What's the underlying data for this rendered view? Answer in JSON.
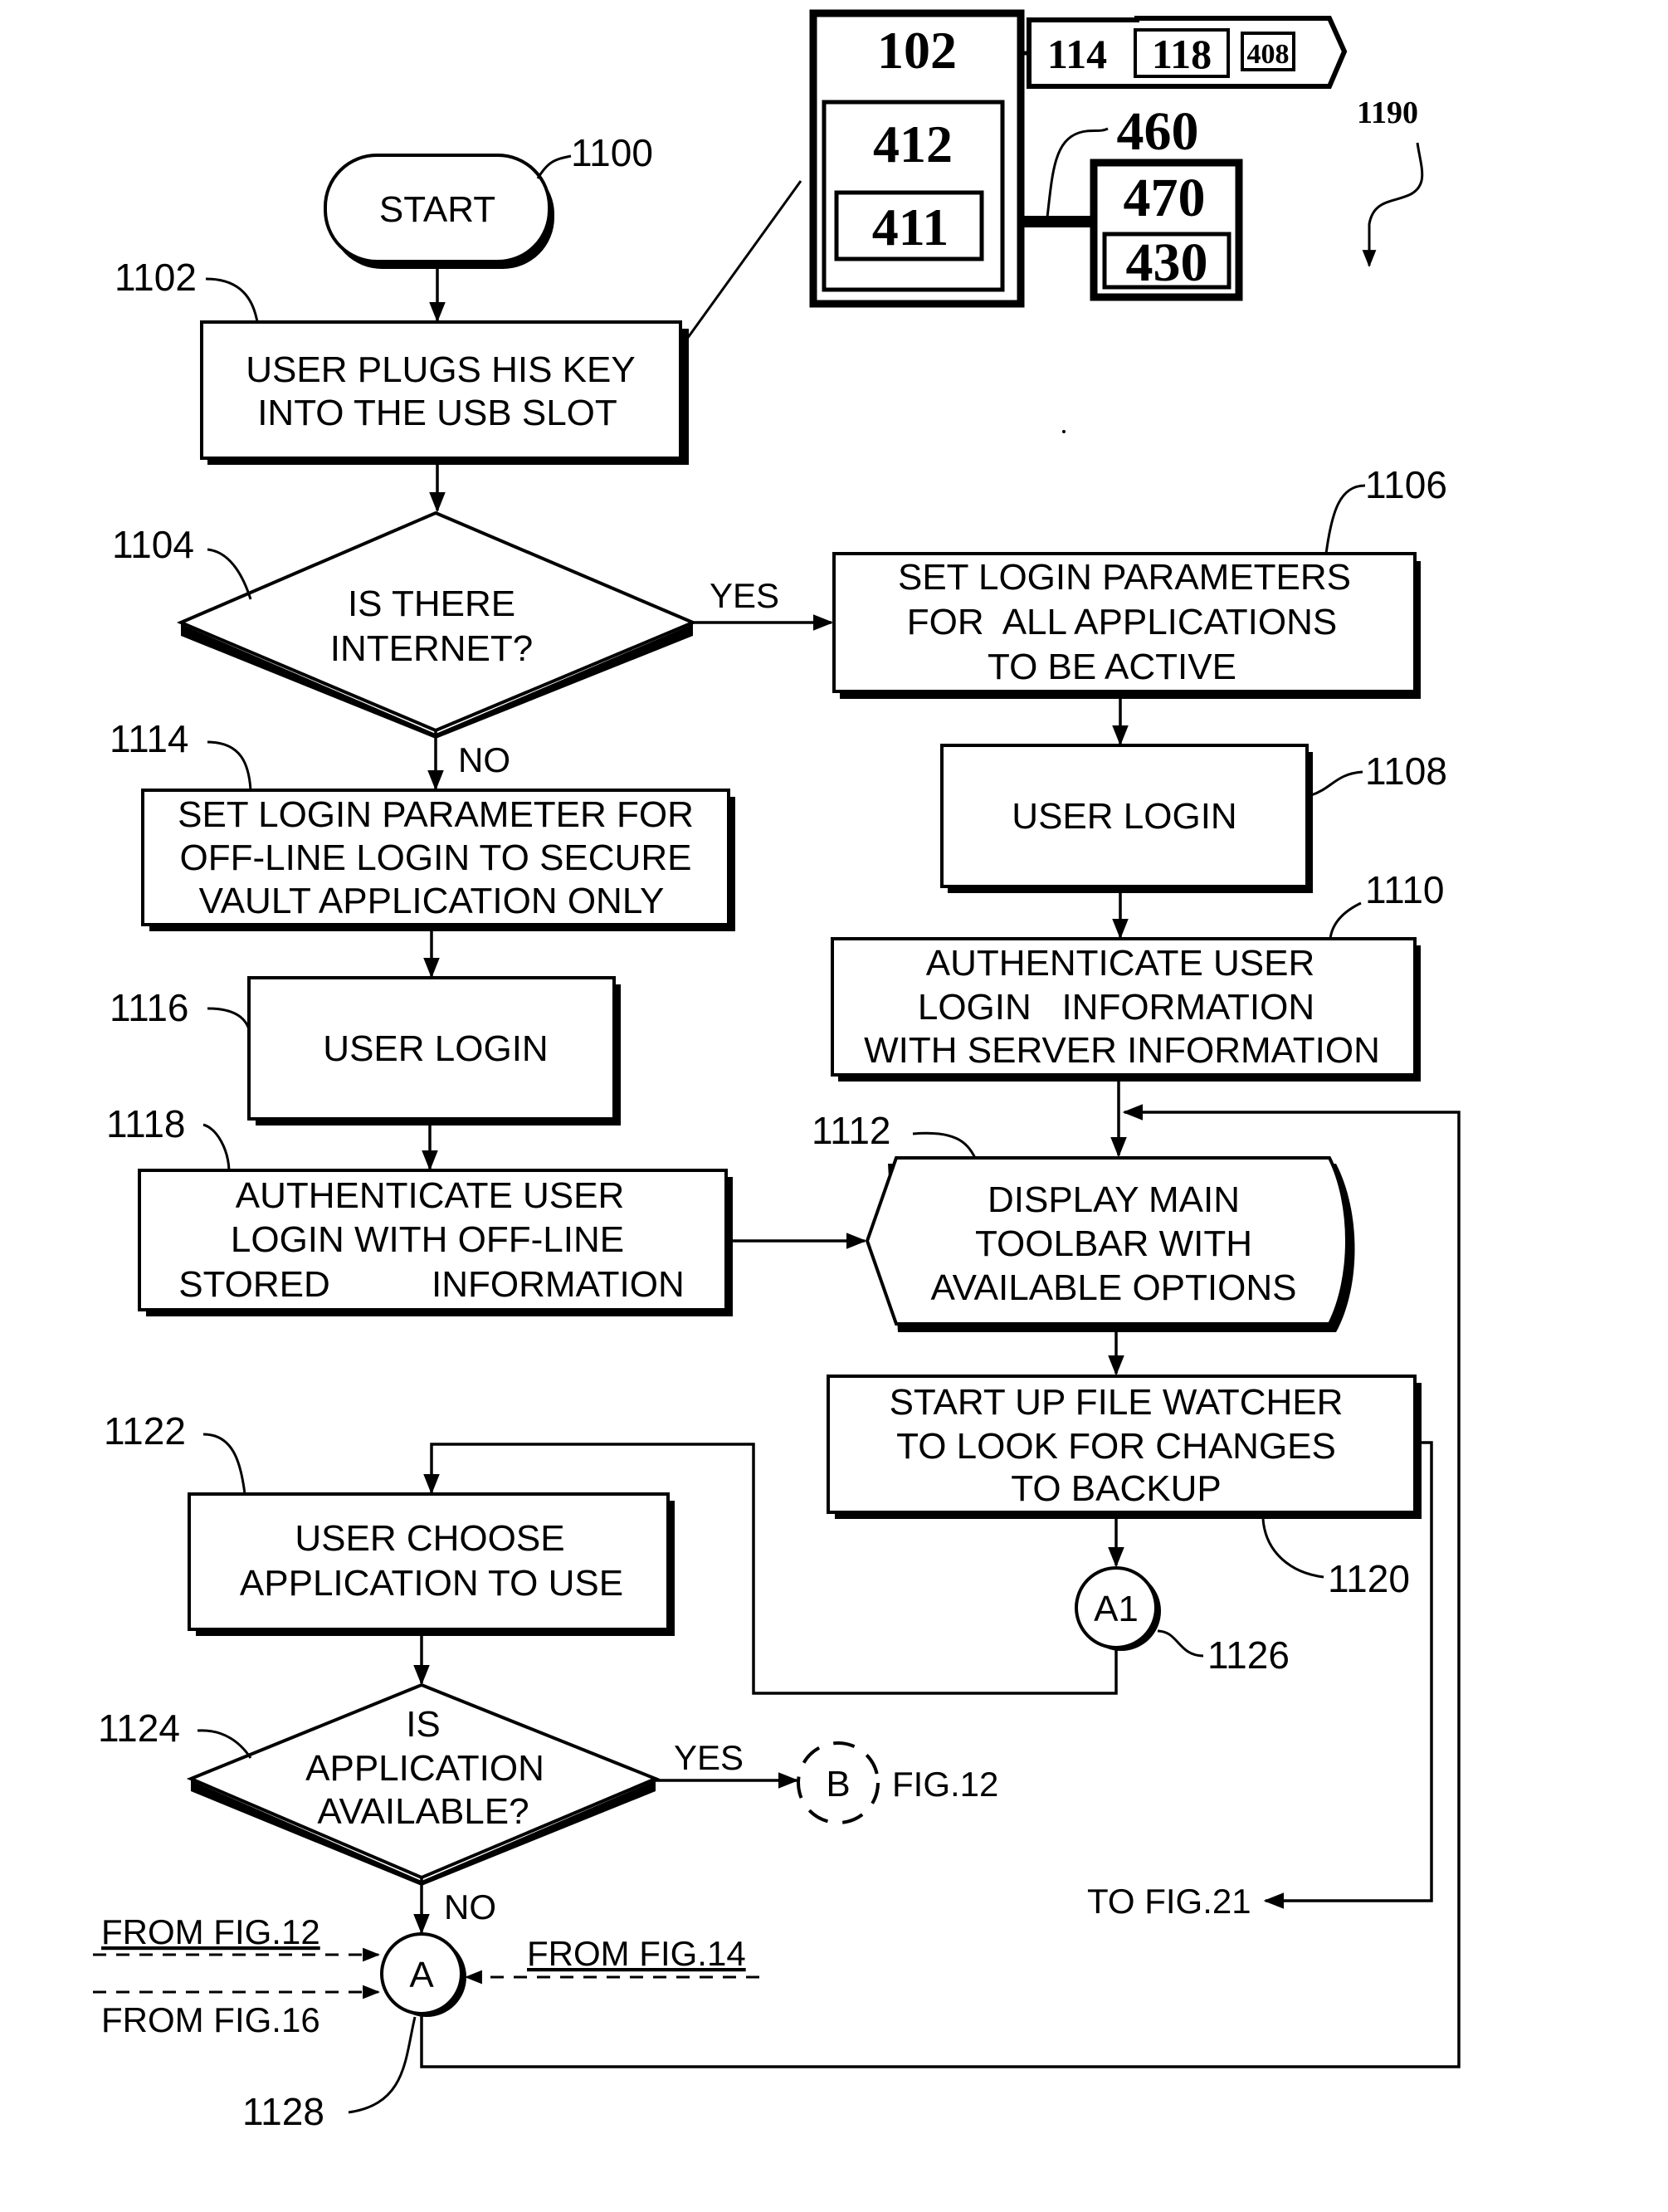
{
  "figure": {
    "title_ref": "1190",
    "device_inset": {
      "key_ref": "102",
      "inner_ref": "412",
      "innermost_ref": "411",
      "tag_refs": [
        "114",
        "118",
        "408"
      ],
      "connector_ref": "460",
      "module_ref": "470",
      "module_inner_ref": "430"
    },
    "nodes": {
      "start": {
        "ref": "1100",
        "lines": [
          "START"
        ]
      },
      "plug_key": {
        "ref": "1102",
        "lines": [
          "USER PLUGS HIS KEY",
          "INTO THE USB SLOT"
        ]
      },
      "internet_check": {
        "ref": "1104",
        "lines": [
          "IS THERE",
          "INTERNET?"
        ]
      },
      "set_params_online": {
        "ref": "1106",
        "lines": [
          "SET LOGIN PARAMETERS",
          "FOR  ALL APPLICATIONS",
          "TO BE ACTIVE"
        ]
      },
      "user_login_online": {
        "ref": "1108",
        "lines": [
          "USER LOGIN"
        ]
      },
      "auth_server": {
        "ref": "1110",
        "lines": [
          "AUTHENTICATE USER",
          "LOGIN   INFORMATION",
          "WITH SERVER INFORMATION"
        ]
      },
      "display_toolbar": {
        "ref": "1112",
        "lines": [
          "DISPLAY MAIN",
          "TOOLBAR WITH",
          "AVAILABLE OPTIONS"
        ]
      },
      "set_params_offline": {
        "ref": "1114",
        "lines": [
          "SET LOGIN PARAMETER FOR",
          "OFF-LINE LOGIN TO SECURE",
          "VAULT APPLICATION ONLY"
        ]
      },
      "user_login_offline": {
        "ref": "1116",
        "lines": [
          "USER LOGIN"
        ]
      },
      "auth_offline": {
        "ref": "1118",
        "lines": [
          "AUTHENTICATE USER",
          "LOGIN WITH OFF-LINE",
          "STORED          INFORMATION"
        ]
      },
      "file_watcher": {
        "ref": "1120",
        "lines": [
          "START UP FILE WATCHER",
          "TO LOOK FOR CHANGES",
          "TO BACKUP"
        ]
      },
      "choose_app": {
        "ref": "1122",
        "lines": [
          "USER CHOOSE",
          "APPLICATION TO USE"
        ]
      },
      "app_available": {
        "ref": "1124",
        "lines": [
          "IS",
          "APPLICATION",
          "AVAILABLE?"
        ]
      },
      "connector_a1": {
        "ref": "1126",
        "label": "A1"
      },
      "connector_a": {
        "ref": "1128",
        "label": "A"
      },
      "connector_b": {
        "label": "B",
        "target": "FIG.12"
      }
    },
    "edge_labels": {
      "yes_internet": "YES",
      "no_internet": "NO",
      "yes_app": "YES",
      "no_app": "NO"
    },
    "off_page": {
      "to_fig21": "TO FIG.21",
      "from_fig12": "FROM FIG.12",
      "from_fig14": "FROM FIG.14",
      "from_fig16": "FROM FIG.16"
    }
  }
}
